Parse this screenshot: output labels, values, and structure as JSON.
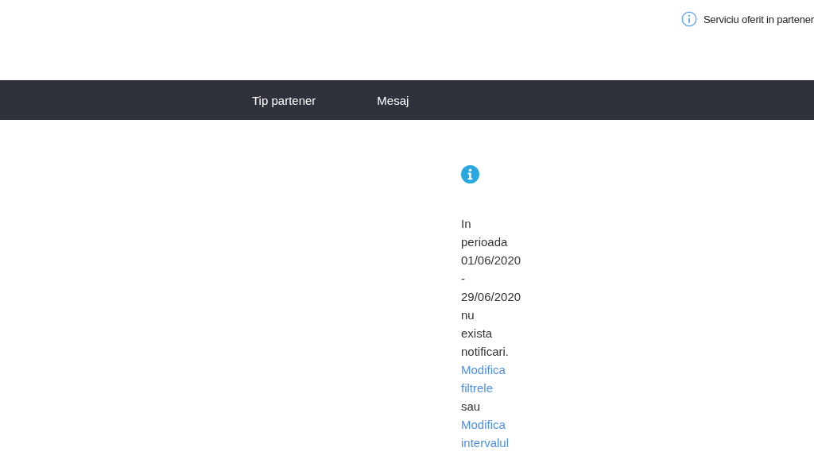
{
  "header": {
    "service_note": "Serviciu oferit in partener"
  },
  "nav": {
    "items": [
      {
        "label": "Tip partener"
      },
      {
        "label": "Mesaj"
      }
    ]
  },
  "message": {
    "lines": [
      {
        "kind": "text",
        "text": "In"
      },
      {
        "kind": "text",
        "text": "perioada"
      },
      {
        "kind": "text",
        "text": "01/06/2020"
      },
      {
        "kind": "text",
        "text": "-"
      },
      {
        "kind": "text",
        "text": "29/06/2020"
      },
      {
        "kind": "text",
        "text": "nu"
      },
      {
        "kind": "text",
        "text": "exista"
      },
      {
        "kind": "text",
        "text": "notificari."
      },
      {
        "kind": "link",
        "text": "Modifica"
      },
      {
        "kind": "link",
        "text": "filtrele"
      },
      {
        "kind": "text",
        "text": "sau"
      },
      {
        "kind": "link",
        "text": "Modifica"
      },
      {
        "kind": "link",
        "text": "intervalul"
      }
    ]
  }
}
